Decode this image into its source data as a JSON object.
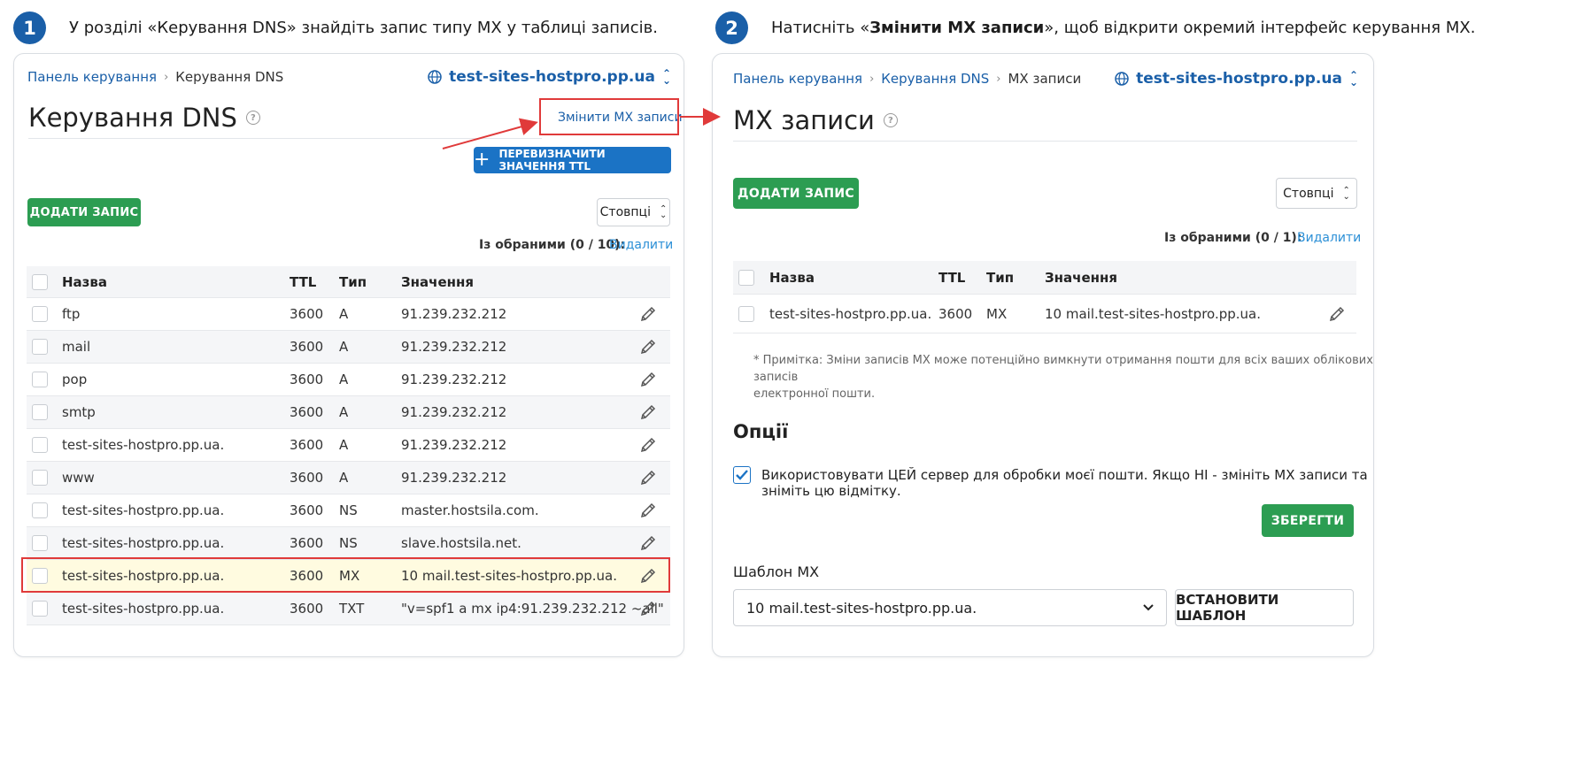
{
  "step1": {
    "number": "1",
    "text": "У розділі «Керування DNS» знайдіть запис типу MX у таблиці записів."
  },
  "step2": {
    "number": "2",
    "text_prefix": "Натисніть «",
    "text_bold": "Змінити MX записи",
    "text_suffix": "», щоб відкрити окремий інтерфейс керування MX."
  },
  "left": {
    "breadcrumb": {
      "home": "Панель керування",
      "sep": "›",
      "current": "Керування DNS"
    },
    "domain": "test-sites-hostpro.pp.ua",
    "title": "Керування DNS",
    "help": "?",
    "change_mx_link": "Змінити MX записи",
    "override_ttl_button": "ПЕРЕВИЗНАЧИТИ ЗНАЧЕННЯ TTL",
    "plus": "+",
    "add_record_button": "ДОДАТИ ЗАПИС",
    "columns_button": "Стовпці",
    "selected_label": "Із обраними (0 / 10):",
    "delete_link": "Видалити",
    "headers": {
      "name": "Назва",
      "ttl": "TTL",
      "type": "Тип",
      "value": "Значення"
    },
    "rows": [
      {
        "name": "ftp",
        "ttl": "3600",
        "type": "A",
        "value": "91.239.232.212"
      },
      {
        "name": "mail",
        "ttl": "3600",
        "type": "A",
        "value": "91.239.232.212"
      },
      {
        "name": "pop",
        "ttl": "3600",
        "type": "A",
        "value": "91.239.232.212"
      },
      {
        "name": "smtp",
        "ttl": "3600",
        "type": "A",
        "value": "91.239.232.212"
      },
      {
        "name": "test-sites-hostpro.pp.ua.",
        "ttl": "3600",
        "type": "A",
        "value": "91.239.232.212"
      },
      {
        "name": "www",
        "ttl": "3600",
        "type": "A",
        "value": "91.239.232.212"
      },
      {
        "name": "test-sites-hostpro.pp.ua.",
        "ttl": "3600",
        "type": "NS",
        "value": "master.hostsila.com."
      },
      {
        "name": "test-sites-hostpro.pp.ua.",
        "ttl": "3600",
        "type": "NS",
        "value": "slave.hostsila.net."
      },
      {
        "name": "test-sites-hostpro.pp.ua.",
        "ttl": "3600",
        "type": "MX",
        "value": "10 mail.test-sites-hostpro.pp.ua."
      },
      {
        "name": "test-sites-hostpro.pp.ua.",
        "ttl": "3600",
        "type": "TXT",
        "value": "\"v=spf1 a mx ip4:91.239.232.212 ~all\""
      }
    ]
  },
  "right": {
    "breadcrumb": {
      "home": "Панель керування",
      "sep": "›",
      "mid": "Керування DNS",
      "current": "MX записи"
    },
    "domain": "test-sites-hostpro.pp.ua",
    "title": "MX записи",
    "help": "?",
    "add_record_button": "ДОДАТИ ЗАПИС",
    "columns_button": "Стовпці",
    "selected_label": "Із обраними (0 / 1):",
    "delete_link": "Видалити",
    "headers": {
      "name": "Назва",
      "ttl": "TTL",
      "type": "Тип",
      "value": "Значення"
    },
    "rows": [
      {
        "name": "test-sites-hostpro.pp.ua.",
        "ttl": "3600",
        "type": "MX",
        "value": "10 mail.test-sites-hostpro.pp.ua."
      }
    ],
    "note_line1": "* Примітка: Зміни записів MX може потенційно вимкнути отримання пошти для всіх ваших облікових записів",
    "note_line2": "електронної пошти.",
    "options_title": "Опції",
    "option_checkbox_label": "Використовувати ЦЕЙ сервер для обробки моєї пошти. Якщо НІ - змініть MX записи та зніміть цю відмітку.",
    "option_checked": true,
    "save_button": "ЗБЕРЕГТИ",
    "template_label": "Шаблон MX",
    "template_selected": "10 mail.test-sites-hostpro.pp.ua.",
    "set_template_button": "ВСТАНОВИТИ ШАБЛОН"
  },
  "colors": {
    "accent_blue": "#1a5fa8",
    "green": "#2c9d52",
    "button_blue": "#1b73c5",
    "highlight_red": "#e03a3a"
  }
}
